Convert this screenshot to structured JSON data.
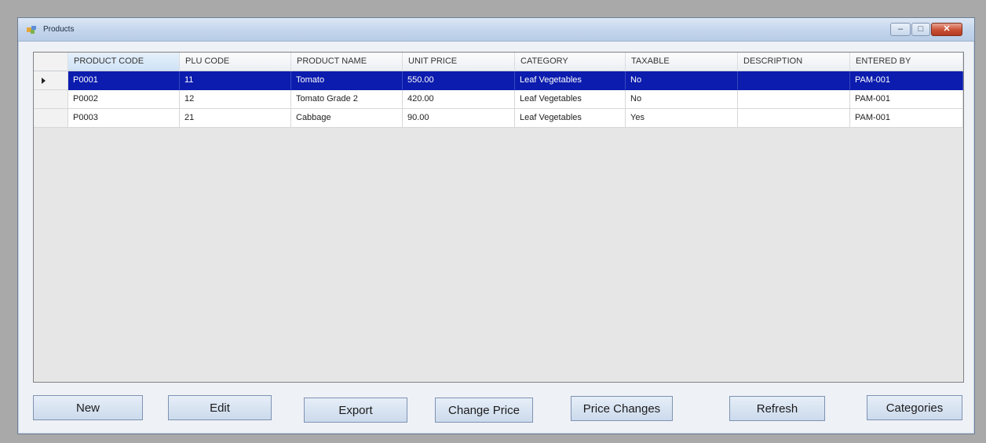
{
  "window": {
    "title": "Products"
  },
  "grid": {
    "columns": [
      "PRODUCT CODE",
      "PLU CODE",
      "PRODUCT NAME",
      "UNIT PRICE",
      "CATEGORY",
      "TAXABLE",
      "DESCRIPTION",
      "ENTERED BY"
    ],
    "rows": [
      [
        "P0001",
        "11",
        "Tomato",
        "550.00",
        "Leaf Vegetables",
        "No",
        "",
        "PAM-001"
      ],
      [
        "P0002",
        "12",
        "Tomato Grade 2",
        "420.00",
        "Leaf Vegetables",
        "No",
        "",
        "PAM-001"
      ],
      [
        "P0003",
        "21",
        "Cabbage",
        "90.00",
        "Leaf Vegetables",
        "Yes",
        "",
        "PAM-001"
      ]
    ],
    "selected_row": 0
  },
  "buttons": {
    "new": "New",
    "edit": "Edit",
    "export": "Export",
    "change_price": "Change Price",
    "price_changes": "Price Changes",
    "refresh": "Refresh",
    "categories": "Categories"
  },
  "colors": {
    "selection": "#0b1cae",
    "close_button": "#c94f33"
  }
}
